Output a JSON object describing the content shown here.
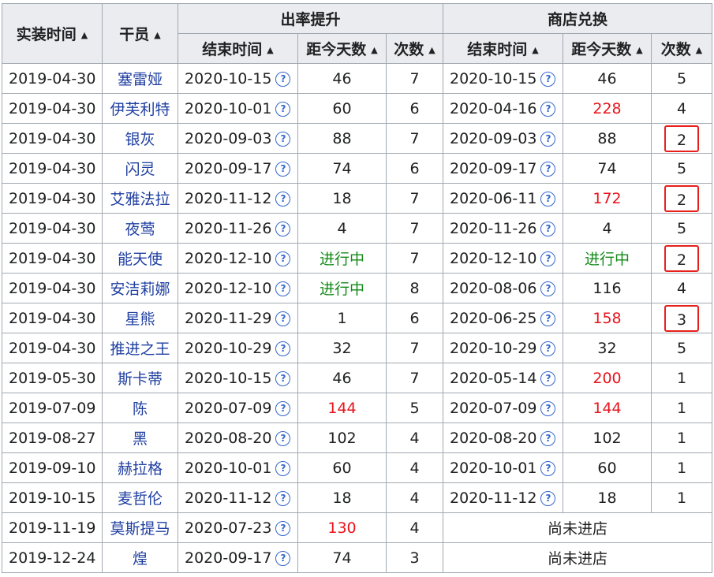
{
  "headers": {
    "install_time": "实装时间",
    "operator": "干员",
    "rate_up": "出率提升",
    "shop": "商店兑换",
    "end_time": "结束时间",
    "days_since": "距今天数",
    "count": "次数",
    "shop_end_time": "结束时间",
    "shop_days_since": "距今天数",
    "shop_count": "次数"
  },
  "help_glyph": "?",
  "rows": [
    {
      "install": "2019-04-30",
      "name": "塞雷娅",
      "rate_end": "2020-10-15",
      "rate_days": "46",
      "rate_days_color": "normal",
      "rate_count": "7",
      "shop_end": "2020-10-15",
      "shop_days": "46",
      "shop_days_color": "normal",
      "shop_count": "5",
      "shop_count_boxed": false
    },
    {
      "install": "2019-04-30",
      "name": "伊芙利特",
      "rate_end": "2020-10-01",
      "rate_days": "60",
      "rate_days_color": "normal",
      "rate_count": "6",
      "shop_end": "2020-04-16",
      "shop_days": "228",
      "shop_days_color": "red",
      "shop_count": "4",
      "shop_count_boxed": false
    },
    {
      "install": "2019-04-30",
      "name": "银灰",
      "rate_end": "2020-09-03",
      "rate_days": "88",
      "rate_days_color": "normal",
      "rate_count": "7",
      "shop_end": "2020-09-03",
      "shop_days": "88",
      "shop_days_color": "normal",
      "shop_count": "2",
      "shop_count_boxed": true
    },
    {
      "install": "2019-04-30",
      "name": "闪灵",
      "rate_end": "2020-09-17",
      "rate_days": "74",
      "rate_days_color": "normal",
      "rate_count": "6",
      "shop_end": "2020-09-17",
      "shop_days": "74",
      "shop_days_color": "normal",
      "shop_count": "5",
      "shop_count_boxed": false
    },
    {
      "install": "2019-04-30",
      "name": "艾雅法拉",
      "rate_end": "2020-11-12",
      "rate_days": "18",
      "rate_days_color": "normal",
      "rate_count": "7",
      "shop_end": "2020-06-11",
      "shop_days": "172",
      "shop_days_color": "red",
      "shop_count": "2",
      "shop_count_boxed": true
    },
    {
      "install": "2019-04-30",
      "name": "夜莺",
      "rate_end": "2020-11-26",
      "rate_days": "4",
      "rate_days_color": "normal",
      "rate_count": "7",
      "shop_end": "2020-11-26",
      "shop_days": "4",
      "shop_days_color": "normal",
      "shop_count": "5",
      "shop_count_boxed": false
    },
    {
      "install": "2019-04-30",
      "name": "能天使",
      "rate_end": "2020-12-10",
      "rate_days": "进行中",
      "rate_days_color": "green",
      "rate_count": "7",
      "shop_end": "2020-12-10",
      "shop_days": "进行中",
      "shop_days_color": "green",
      "shop_count": "2",
      "shop_count_boxed": true
    },
    {
      "install": "2019-04-30",
      "name": "安洁莉娜",
      "rate_end": "2020-12-10",
      "rate_days": "进行中",
      "rate_days_color": "green",
      "rate_count": "8",
      "shop_end": "2020-08-06",
      "shop_days": "116",
      "shop_days_color": "normal",
      "shop_count": "4",
      "shop_count_boxed": false
    },
    {
      "install": "2019-04-30",
      "name": "星熊",
      "rate_end": "2020-11-29",
      "rate_days": "1",
      "rate_days_color": "normal",
      "rate_count": "6",
      "shop_end": "2020-06-25",
      "shop_days": "158",
      "shop_days_color": "red",
      "shop_count": "3",
      "shop_count_boxed": true
    },
    {
      "install": "2019-04-30",
      "name": "推进之王",
      "rate_end": "2020-10-29",
      "rate_days": "32",
      "rate_days_color": "normal",
      "rate_count": "7",
      "shop_end": "2020-10-29",
      "shop_days": "32",
      "shop_days_color": "normal",
      "shop_count": "5",
      "shop_count_boxed": false
    },
    {
      "install": "2019-05-30",
      "name": "斯卡蒂",
      "rate_end": "2020-10-15",
      "rate_days": "46",
      "rate_days_color": "normal",
      "rate_count": "7",
      "shop_end": "2020-05-14",
      "shop_days": "200",
      "shop_days_color": "red",
      "shop_count": "1",
      "shop_count_boxed": false
    },
    {
      "install": "2019-07-09",
      "name": "陈",
      "rate_end": "2020-07-09",
      "rate_days": "144",
      "rate_days_color": "red",
      "rate_count": "5",
      "shop_end": "2020-07-09",
      "shop_days": "144",
      "shop_days_color": "red",
      "shop_count": "1",
      "shop_count_boxed": false
    },
    {
      "install": "2019-08-27",
      "name": "黑",
      "rate_end": "2020-08-20",
      "rate_days": "102",
      "rate_days_color": "normal",
      "rate_count": "4",
      "shop_end": "2020-08-20",
      "shop_days": "102",
      "shop_days_color": "normal",
      "shop_count": "1",
      "shop_count_boxed": false
    },
    {
      "install": "2019-09-10",
      "name": "赫拉格",
      "rate_end": "2020-10-01",
      "rate_days": "60",
      "rate_days_color": "normal",
      "rate_count": "4",
      "shop_end": "2020-10-01",
      "shop_days": "60",
      "shop_days_color": "normal",
      "shop_count": "1",
      "shop_count_boxed": false
    },
    {
      "install": "2019-10-15",
      "name": "麦哲伦",
      "rate_end": "2020-11-12",
      "rate_days": "18",
      "rate_days_color": "normal",
      "rate_count": "4",
      "shop_end": "2020-11-12",
      "shop_days": "18",
      "shop_days_color": "normal",
      "shop_count": "1",
      "shop_count_boxed": false
    },
    {
      "install": "2019-11-19",
      "name": "莫斯提马",
      "rate_end": "2020-07-23",
      "rate_days": "130",
      "rate_days_color": "red",
      "rate_count": "4",
      "shop_not_in_store": "尚未进店"
    },
    {
      "install": "2019-12-24",
      "name": "煌",
      "rate_end": "2020-09-17",
      "rate_days": "74",
      "rate_days_color": "normal",
      "rate_count": "3",
      "shop_not_in_store": "尚未进店"
    }
  ]
}
